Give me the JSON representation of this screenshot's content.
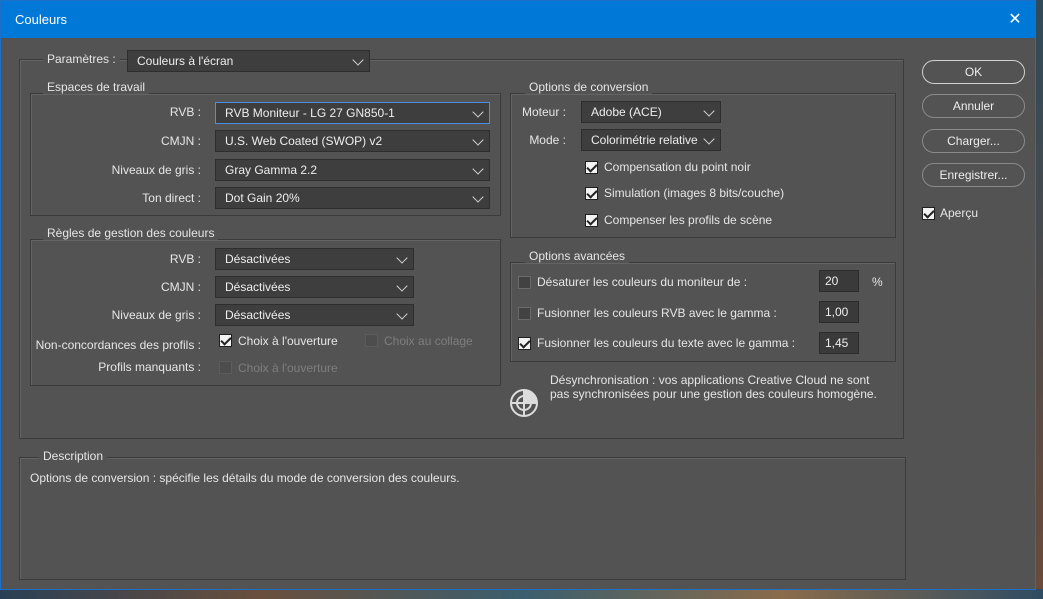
{
  "window": {
    "title": "Couleurs",
    "close_glyph": "✕"
  },
  "parametres": {
    "label": "Paramètres :",
    "value": "Couleurs à l'écran"
  },
  "espaces": {
    "title": "Espaces de travail",
    "rvb_label": "RVB :",
    "rvb_value": "RVB Moniteur - LG 27 GN850-1",
    "cmjn_label": "CMJN :",
    "cmjn_value": "U.S. Web Coated (SWOP) v2",
    "gris_label": "Niveaux de gris :",
    "gris_value": "Gray Gamma 2.2",
    "ton_label": "Ton direct :",
    "ton_value": "Dot Gain 20%"
  },
  "regles": {
    "title": "Règles de gestion des couleurs",
    "rvb_label": "RVB :",
    "rvb_value": "Désactivées",
    "cmjn_label": "CMJN :",
    "cmjn_value": "Désactivées",
    "gris_label": "Niveaux de gris :",
    "gris_value": "Désactivées",
    "nonconc_label": "Non-concordances des profils :",
    "choix_ouverture": "Choix à l'ouverture",
    "choix_collage": "Choix au collage",
    "manquants_label": "Profils manquants :",
    "manquants_choix": "Choix à l'ouverture"
  },
  "conversion": {
    "title": "Options de conversion",
    "moteur_label": "Moteur :",
    "moteur_value": "Adobe (ACE)",
    "mode_label": "Mode :",
    "mode_value": "Colorimétrie relative",
    "compensation": "Compensation du point noir",
    "simulation": "Simulation (images 8 bits/couche)",
    "compenser": "Compenser les profils de scène"
  },
  "avancees": {
    "title": "Options avancées",
    "desaturer_label": "Désaturer les couleurs du moniteur de :",
    "desaturer_value": "20",
    "desaturer_unit": "%",
    "fusion_rvb_label": "Fusionner les couleurs RVB avec le gamma :",
    "fusion_rvb_value": "1,00",
    "fusion_texte_label": "Fusionner les couleurs du texte avec le gamma :",
    "fusion_texte_value": "1,45"
  },
  "sync_message": {
    "line1": "Désynchronisation : vos applications Creative Cloud ne sont",
    "line2": "pas synchronisées pour une gestion des couleurs homogène."
  },
  "buttons": {
    "ok": "OK",
    "annuler": "Annuler",
    "charger": "Charger...",
    "enregistrer": "Enregistrer..."
  },
  "apercu": {
    "label": "Aperçu",
    "checked": true
  },
  "description": {
    "title": "Description",
    "text": "Options de conversion : spécifie les détails du mode de conversion des couleurs."
  },
  "colors": {
    "titlebar": "#0078d7",
    "dialog_bg": "#535353",
    "accent_focus": "#4c8fe0"
  }
}
